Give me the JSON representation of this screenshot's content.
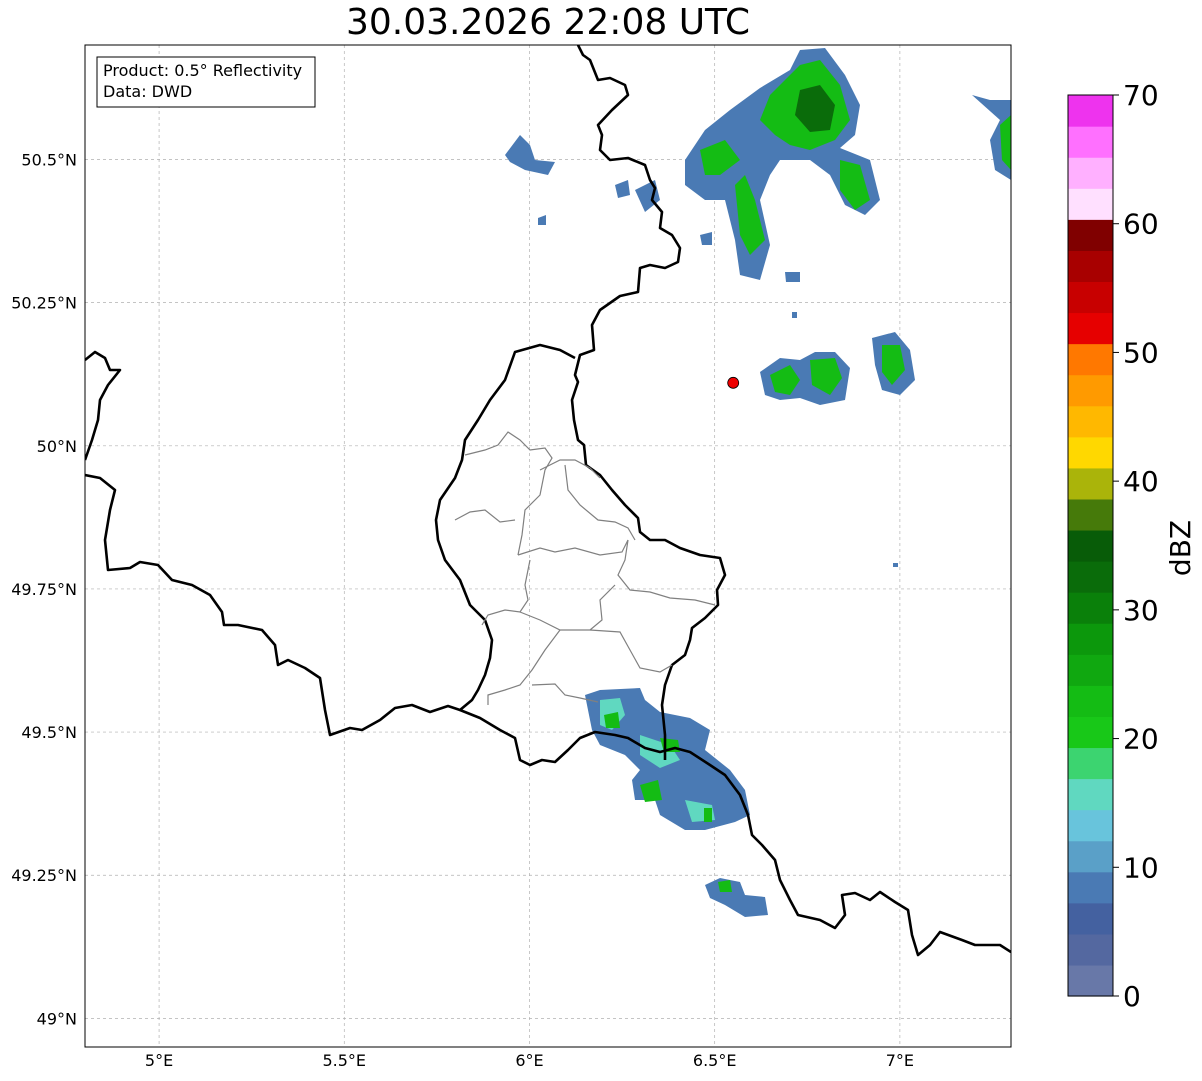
{
  "title": "30.03.2026 22:08 UTC",
  "info_box": {
    "line1": "Product: 0.5° Reflectivity",
    "line2": "Data: DWD"
  },
  "map": {
    "lon_ticks": [
      {
        "value": 5.0,
        "label": "5°E"
      },
      {
        "value": 5.5,
        "label": "5.5°E"
      },
      {
        "value": 6.0,
        "label": "6°E"
      },
      {
        "value": 6.5,
        "label": "6.5°E"
      },
      {
        "value": 7.0,
        "label": "7°E"
      }
    ],
    "lat_ticks": [
      {
        "value": 50.5,
        "label": "50.5°N"
      },
      {
        "value": 50.25,
        "label": "50.25°N"
      },
      {
        "value": 50.0,
        "label": "50°N"
      },
      {
        "value": 49.75,
        "label": "49.75°N"
      },
      {
        "value": 49.5,
        "label": "49.5°N"
      },
      {
        "value": 49.25,
        "label": "49.25°N"
      },
      {
        "value": 49.0,
        "label": "49°N"
      }
    ],
    "extent": {
      "lon": [
        4.8,
        7.3
      ],
      "lat": [
        48.95,
        50.7
      ]
    },
    "radar_site": {
      "lon": 6.55,
      "lat": 50.11,
      "color": "#ee0000"
    }
  },
  "colorbar": {
    "label": "dBZ",
    "range": [
      0,
      70
    ],
    "ticks": [
      "0",
      "10",
      "20",
      "30",
      "40",
      "50",
      "60",
      "70"
    ],
    "colors": [
      "#6878a8",
      "#5468a0",
      "#4461a0",
      "#4a7ab4",
      "#5aa0c8",
      "#68c4dc",
      "#60d8c0",
      "#3cd470",
      "#18c818",
      "#14bc14",
      "#10a810",
      "#0c980c",
      "#0a800a",
      "#0a6c0a",
      "#085c08",
      "#467a0a",
      "#aab40a",
      "#ffd800",
      "#ffb800",
      "#ff9a00",
      "#ff7800",
      "#e60000",
      "#c80000",
      "#a80000",
      "#800000",
      "#ffe0ff",
      "#ffb0ff",
      "#ff70ff",
      "#ee33ee"
    ]
  }
}
